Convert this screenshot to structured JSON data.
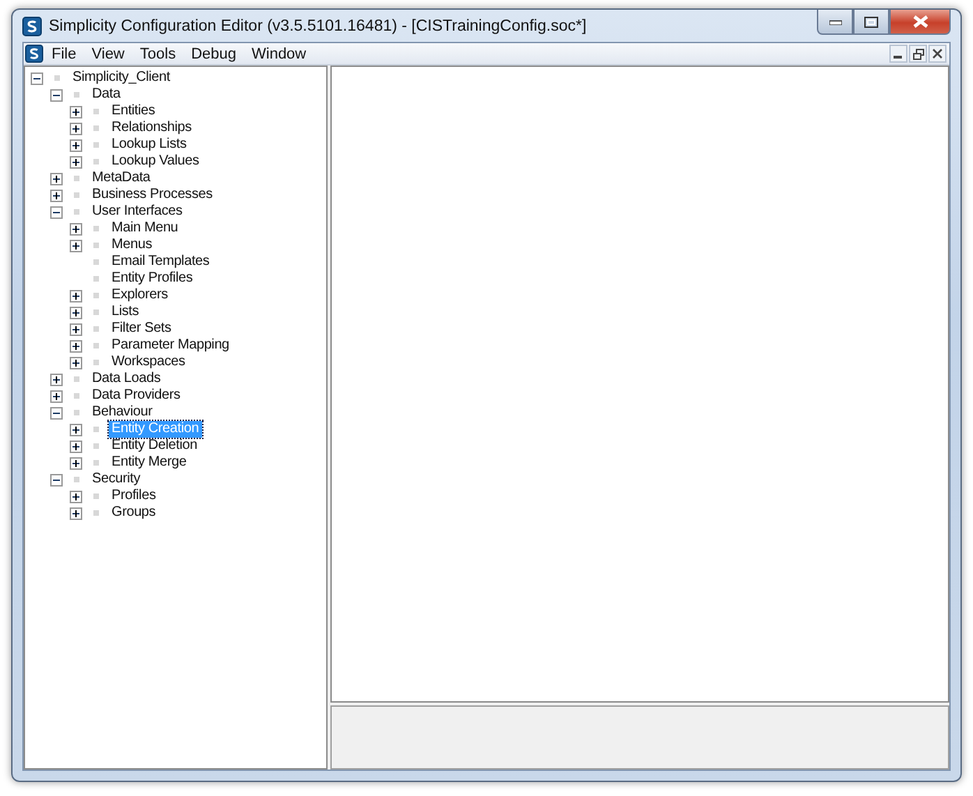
{
  "window": {
    "title": "Simplicity Configuration Editor (v3.5.5101.16481) - [CISTrainingConfig.soc*]"
  },
  "menu": [
    "File",
    "View",
    "Tools",
    "Debug",
    "Window"
  ],
  "tree": [
    {
      "label": "Simplicity_Client",
      "expanded": true,
      "selected": false,
      "children": [
        {
          "label": "Data",
          "expanded": true,
          "selected": false,
          "children": [
            {
              "label": "Entities",
              "expanded": false,
              "selected": false
            },
            {
              "label": "Relationships",
              "expanded": false,
              "selected": false
            },
            {
              "label": "Lookup Lists",
              "expanded": false,
              "selected": false
            },
            {
              "label": "Lookup Values",
              "expanded": false,
              "selected": false
            }
          ]
        },
        {
          "label": "MetaData",
          "expanded": false,
          "selected": false
        },
        {
          "label": "Business Processes",
          "expanded": false,
          "selected": false
        },
        {
          "label": "User Interfaces",
          "expanded": true,
          "selected": false,
          "children": [
            {
              "label": "Main Menu",
              "expanded": false,
              "selected": false
            },
            {
              "label": "Menus",
              "expanded": false,
              "selected": false
            },
            {
              "label": "Email Templates",
              "selected": false
            },
            {
              "label": "Entity Profiles",
              "selected": false
            },
            {
              "label": "Explorers",
              "expanded": false,
              "selected": false
            },
            {
              "label": "Lists",
              "expanded": false,
              "selected": false
            },
            {
              "label": "Filter Sets",
              "expanded": false,
              "selected": false
            },
            {
              "label": "Parameter Mapping",
              "expanded": false,
              "selected": false
            },
            {
              "label": "Workspaces",
              "expanded": false,
              "selected": false
            }
          ]
        },
        {
          "label": "Data Loads",
          "expanded": false,
          "selected": false
        },
        {
          "label": "Data Providers",
          "expanded": false,
          "selected": false
        },
        {
          "label": "Behaviour",
          "expanded": true,
          "selected": false,
          "children": [
            {
              "label": "Entity Creation",
              "expanded": false,
              "selected": true
            },
            {
              "label": "Entity Deletion",
              "expanded": false,
              "selected": false
            },
            {
              "label": "Entity Merge",
              "expanded": false,
              "selected": false
            }
          ]
        },
        {
          "label": "Security",
          "expanded": true,
          "selected": false,
          "children": [
            {
              "label": "Profiles",
              "expanded": false,
              "selected": false
            },
            {
              "label": "Groups",
              "expanded": false,
              "selected": false
            }
          ]
        }
      ]
    }
  ]
}
